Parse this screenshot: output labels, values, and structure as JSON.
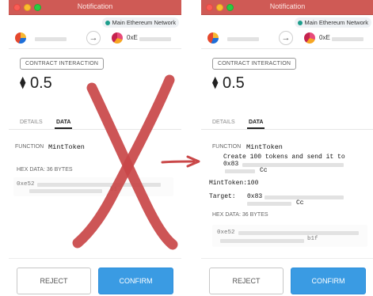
{
  "before": {
    "title": "Notification",
    "network": "Main Ethereum Network",
    "to_prefix": "0xE",
    "interaction_label": "CONTRACT INTERACTION",
    "amount": "0.5",
    "tabs": [
      "DETAILS",
      "DATA"
    ],
    "function_label": "FUNCTION",
    "function_name": "MintToken",
    "hex_label": "HEX DATA: 36 BYTES",
    "hex_prefix": "0xe52",
    "hex_suffix": "b1",
    "reject": "REJECT",
    "confirm": "CONFIRM"
  },
  "after": {
    "title": "Notification",
    "network": "Main Ethereum Network",
    "to_prefix": "0xE",
    "interaction_label": "CONTRACT INTERACTION",
    "amount": "0.5",
    "tabs": [
      "DETAILS",
      "DATA"
    ],
    "function_label": "FUNCTION",
    "function_name": "MintToken",
    "description_line1": "Create 100 tokens and send it to",
    "description_prefix": "0x83",
    "description_suffix": "Cc",
    "mint_label": "MintToken:",
    "mint_value": "100",
    "target_label": "Target:",
    "target_prefix": "0x83",
    "target_suffix": "Cc",
    "hex_label": "HEX DATA: 36 BYTES",
    "hex_prefix": "0xe52",
    "hex_suffix": "b1f",
    "reject": "REJECT",
    "confirm": "CONFIRM"
  },
  "colors": {
    "titlebar": "#cf5a55",
    "confirm": "#3a9be3",
    "network_dot": "#1d9e8c",
    "annotation_red": "#c94748"
  },
  "icons": [
    "ethereum-icon",
    "forward-arrow-icon",
    "red-x-mark",
    "red-arrow"
  ]
}
